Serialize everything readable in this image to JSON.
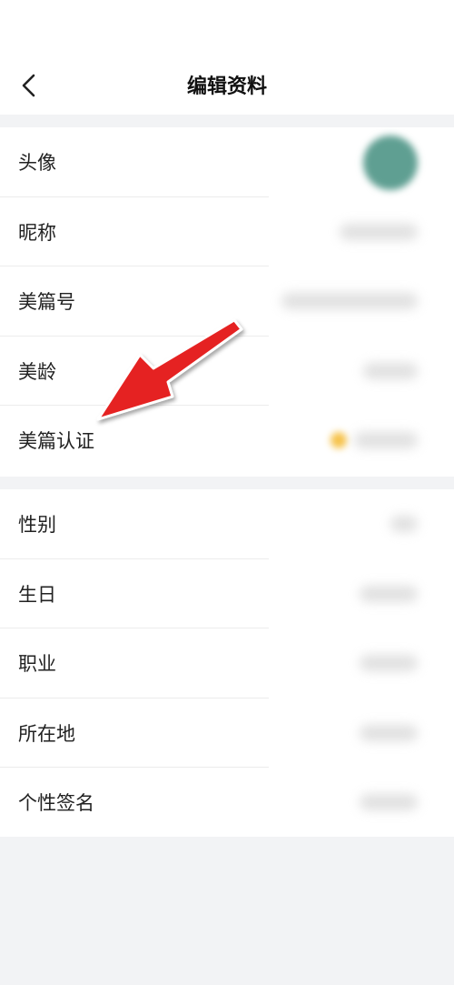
{
  "header": {
    "title": "编辑资料",
    "back_icon": "chevron-left-icon"
  },
  "profile_group_1": [
    {
      "label": "头像"
    },
    {
      "label": "昵称"
    },
    {
      "label": "美篇号"
    },
    {
      "label": "美龄"
    },
    {
      "label": "美篇认证"
    }
  ],
  "profile_group_2": [
    {
      "label": "性别"
    },
    {
      "label": "生日"
    },
    {
      "label": "职业"
    },
    {
      "label": "所在地"
    },
    {
      "label": "个性签名"
    }
  ],
  "colors": {
    "background": "#f2f3f5",
    "annotation_arrow": "#e52421",
    "avatar": "#5f9f92"
  }
}
